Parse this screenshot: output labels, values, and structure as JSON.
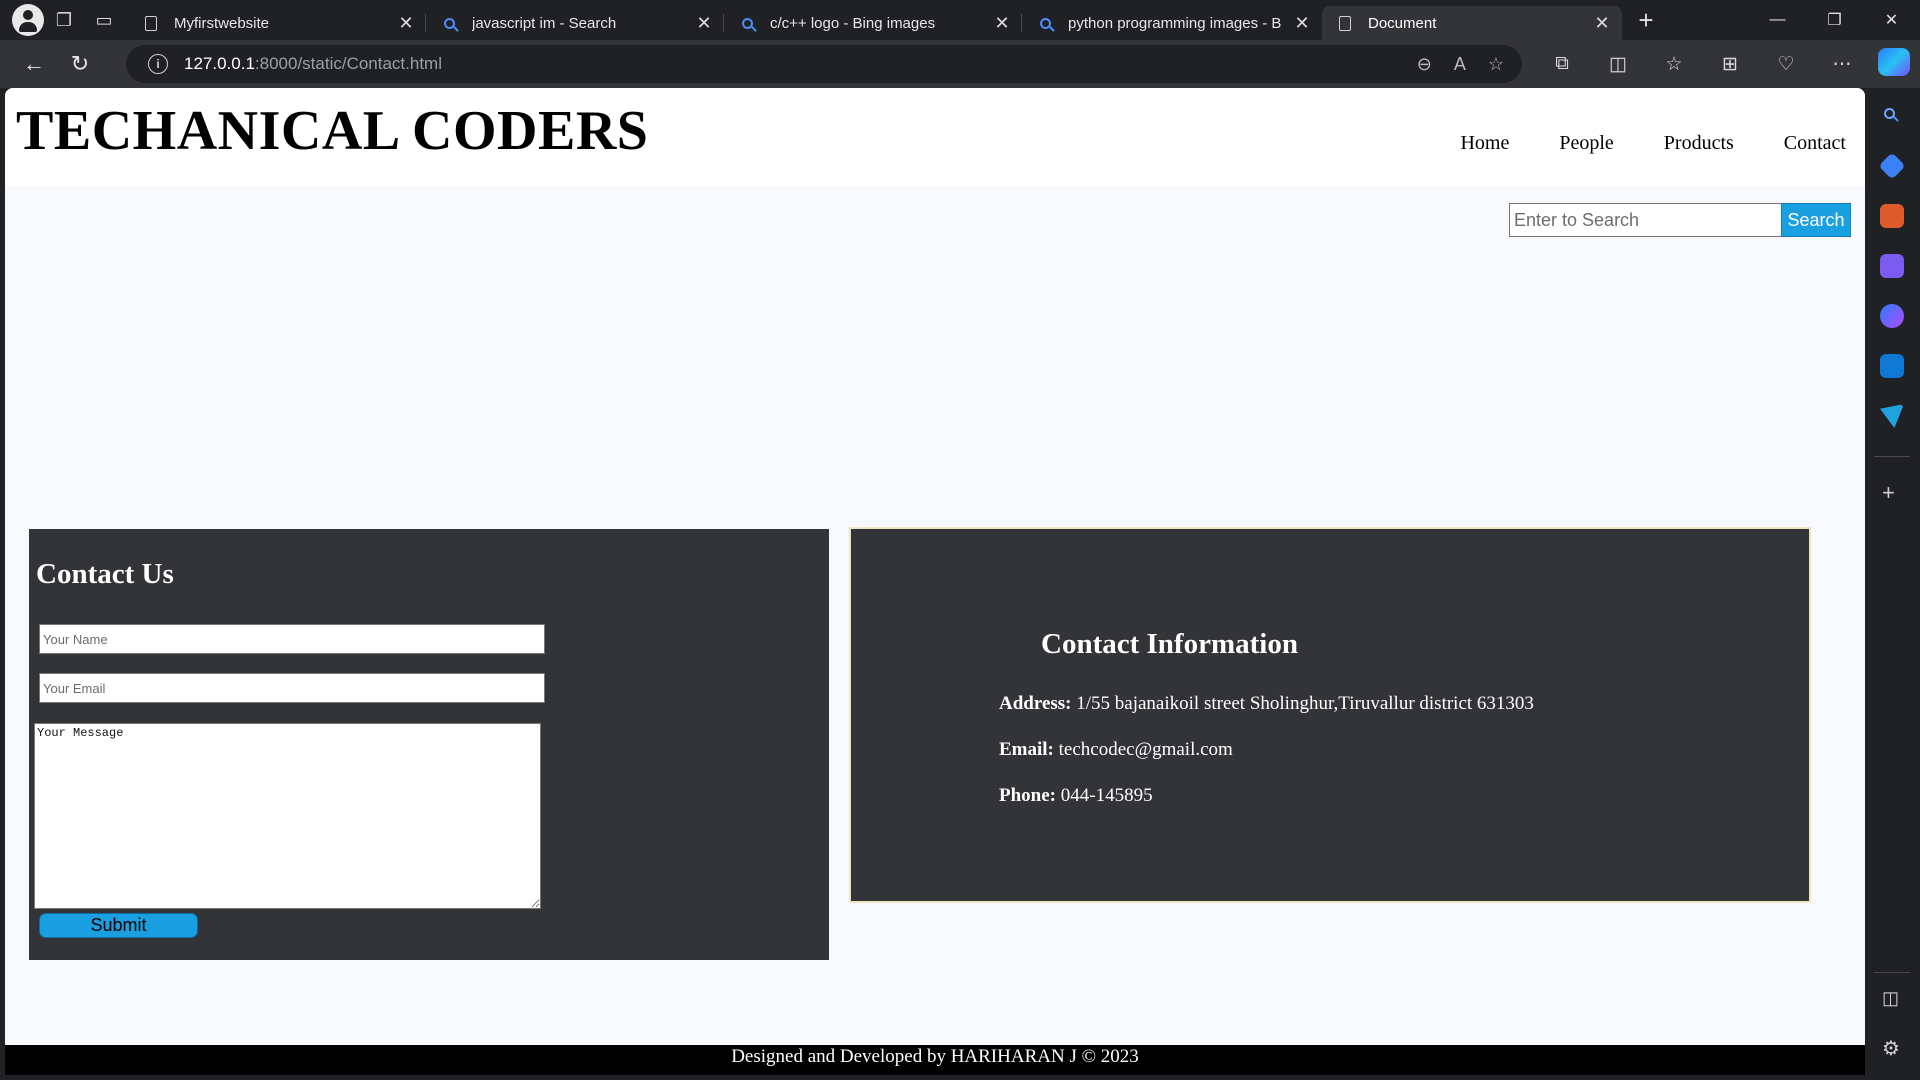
{
  "browser": {
    "tabs": [
      {
        "title": "Myfirstwebsite",
        "icon": "document-icon",
        "active": false
      },
      {
        "title": "javascript im - Search",
        "icon": "search-icon",
        "active": false
      },
      {
        "title": "c/c++ logo - Bing images",
        "icon": "search-icon",
        "active": false
      },
      {
        "title": "python programming images - B",
        "icon": "search-icon",
        "active": false
      },
      {
        "title": "Document",
        "icon": "document-icon",
        "active": true
      }
    ],
    "url_host": "127.0.0.1",
    "url_rest": ":8000/static/Contact.html"
  },
  "site": {
    "brand": "TECHANICAL CODERS",
    "nav": [
      "Home",
      "People",
      "Products",
      "Contact"
    ],
    "search": {
      "placeholder": "Enter to Search",
      "button": "Search"
    },
    "contact_form": {
      "heading": "Contact Us",
      "name_placeholder": "Your Name",
      "email_placeholder": "Your Email",
      "message_placeholder": "Your Message",
      "submit": "Submit"
    },
    "contact_info": {
      "heading": "Contact Information",
      "address_label": "Address:",
      "address": "1/55 bajanaikoil street Sholinghur,Tiruvallur district 631303",
      "email_label": "Email:",
      "email": "techcodec@gmail.com",
      "phone_label": "Phone:",
      "phone": "044-145895"
    },
    "footer": "Designed and Developed by HARIHARAN J © 2023"
  },
  "colors": {
    "accent_blue": "#1a9fe0",
    "panel": "#333437",
    "page_bg": "#f8f9fd"
  }
}
